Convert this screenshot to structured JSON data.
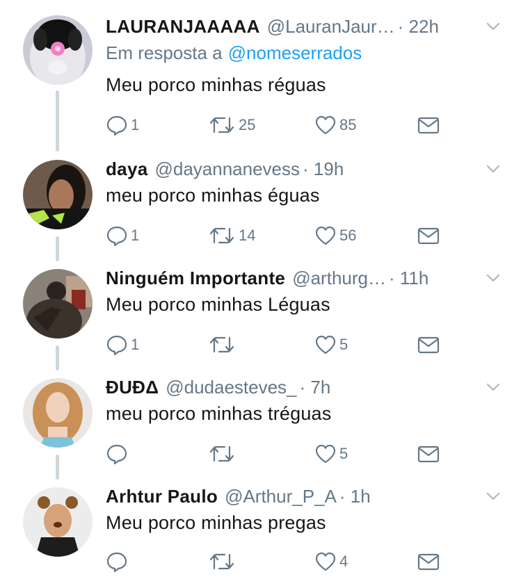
{
  "colors": {
    "text": "#14171a",
    "muted": "#657786",
    "link": "#1da1f2",
    "thread_line": "#ccd6dd"
  },
  "icons": {
    "reply": "reply-icon",
    "retweet": "retweet-icon",
    "like": "heart-icon",
    "dm": "envelope-icon",
    "menu": "chevron-down-icon"
  },
  "tweets": [
    {
      "name": "LAURANJAAAAA",
      "handle": "@LauranJaur…",
      "time": "22h",
      "reply_prefix": "Em resposta a",
      "reply_mention": "@nomeserrados",
      "text": "Meu porco minhas réguas",
      "replies": "1",
      "retweets": "25",
      "likes": "85"
    },
    {
      "name": "daya",
      "handle": "@dayannanevess",
      "time": "19h",
      "text": "meu porco minhas éguas",
      "replies": "1",
      "retweets": "14",
      "likes": "56"
    },
    {
      "name": "Ninguém Importante",
      "handle": "@arthurg…",
      "time": "11h",
      "text": "Meu porco minhas Léguas",
      "replies": "1",
      "retweets": "",
      "likes": "5"
    },
    {
      "name": "ĐUĐΔ",
      "handle": "@dudaesteves_",
      "time": "7h",
      "text": "meu porco minhas tréguas",
      "replies": "",
      "retweets": "",
      "likes": "5"
    },
    {
      "name": "Arhtur Paulo",
      "handle": "@Arthur_P_A",
      "time": "1h",
      "text": "Meu porco minhas pregas",
      "replies": "",
      "retweets": "",
      "likes": "4"
    }
  ]
}
